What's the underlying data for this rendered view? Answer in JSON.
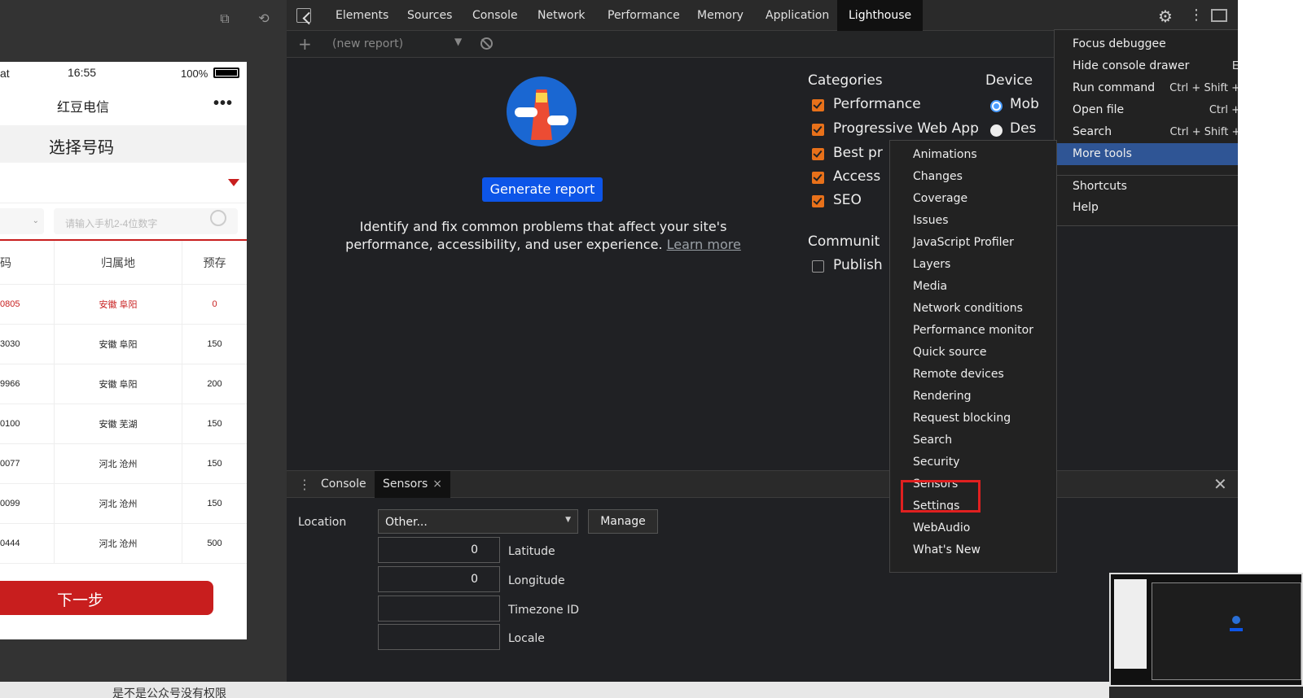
{
  "device": {
    "status": {
      "carrier": "at",
      "time": "16:55",
      "battery": "100%"
    },
    "nav_title": "红豆电信",
    "nav_more": "•••",
    "page_title": "选择号码",
    "select_caret": "⌄",
    "search_placeholder": "请输入手机2-4位数字",
    "table_headers": [
      "码",
      "归属地",
      "预存"
    ],
    "rows": [
      {
        "num": "0805",
        "loc": "安徽 阜阳",
        "amt": "0"
      },
      {
        "num": "3030",
        "loc": "安徽 阜阳",
        "amt": "150"
      },
      {
        "num": "9966",
        "loc": "安徽 阜阳",
        "amt": "200"
      },
      {
        "num": "0100",
        "loc": "安徽 芜湖",
        "amt": "150"
      },
      {
        "num": "0077",
        "loc": "河北 沧州",
        "amt": "150"
      },
      {
        "num": "0099",
        "loc": "河北 沧州",
        "amt": "150"
      },
      {
        "num": "0444",
        "loc": "河北 沧州",
        "amt": "500"
      }
    ],
    "next_button": "下一步"
  },
  "tabs": [
    "Elements",
    "Sources",
    "Console",
    "Network",
    "Performance",
    "Memory",
    "Application",
    "Lighthouse"
  ],
  "active_tab": "Lighthouse",
  "subbar": {
    "report_select": "(new report)"
  },
  "lighthouse": {
    "generate_button": "Generate report",
    "description": "Identify and fix common problems that affect your site's performance, accessibility, and user experience.",
    "learn_more": "Learn more",
    "categories_heading": "Categories",
    "categories": [
      {
        "label": "Performance",
        "checked": true
      },
      {
        "label": "Progressive Web App",
        "checked": true
      },
      {
        "label": "Best pr",
        "checked": true
      },
      {
        "label": "Access",
        "checked": true
      },
      {
        "label": "SEO",
        "checked": true
      }
    ],
    "device_heading": "Device",
    "devices": [
      {
        "label": "Mob",
        "selected": true
      },
      {
        "label": "Des",
        "selected": false
      }
    ],
    "community_heading": "Communit",
    "community_item": {
      "label": "Publish",
      "checked": false
    }
  },
  "drawer": {
    "tabs": [
      "Console",
      "Sensors"
    ],
    "active_tab": "Sensors",
    "close_tab": "×",
    "close_drawer": "✕",
    "sensors": {
      "location_label": "Location",
      "location_value": "Other...",
      "manage_button": "Manage",
      "fields": [
        {
          "label": "Latitude",
          "value": "0"
        },
        {
          "label": "Longitude",
          "value": "0"
        },
        {
          "label": "Timezone ID",
          "value": ""
        },
        {
          "label": "Locale",
          "value": ""
        }
      ]
    }
  },
  "main_menu": [
    {
      "label": "Focus debuggee",
      "shortcut": ""
    },
    {
      "label": "Hide console drawer",
      "shortcut": "Esc"
    },
    {
      "label": "Run command",
      "shortcut": "Ctrl + Shift + P"
    },
    {
      "label": "Open file",
      "shortcut": "Ctrl + P"
    },
    {
      "label": "Search",
      "shortcut": "Ctrl + Shift + F"
    },
    {
      "label": "More tools",
      "shortcut": ""
    },
    {
      "label": "Shortcuts",
      "shortcut": ""
    },
    {
      "label": "Help",
      "shortcut": ""
    }
  ],
  "more_tools_menu": [
    "Animations",
    "Changes",
    "Coverage",
    "Issues",
    "JavaScript Profiler",
    "Layers",
    "Media",
    "Network conditions",
    "Performance monitor",
    "Quick source",
    "Remote devices",
    "Rendering",
    "Request blocking",
    "Search",
    "Security",
    "Sensors",
    "Settings",
    "WebAudio",
    "What's New"
  ],
  "bottom_text": "是不是公众号没有权限",
  "colors": {
    "accent_blue": "#0d55e8",
    "checkbox_orange": "#e8711a",
    "highlight_red": "#e02020",
    "menu_selected": "#2f5595",
    "brand_red": "#c81e1e"
  }
}
